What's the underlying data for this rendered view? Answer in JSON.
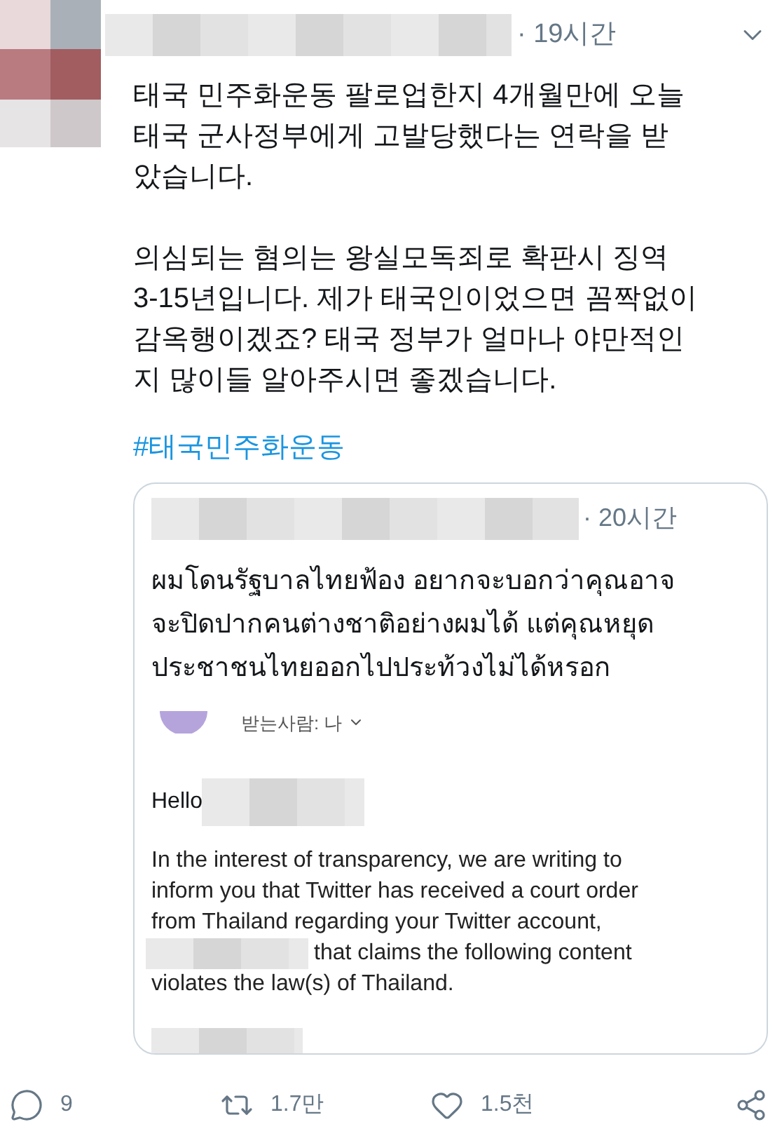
{
  "tweet": {
    "time": "· 19시간",
    "paragraphs": [
      [
        "태국 민주화운동 팔로업한지 4개월만에 오늘",
        "태국 군사정부에게 고발당했다는 연락을 받",
        "았습니다."
      ],
      [
        "의심되는 혐의는 왕실모독죄로 확판시 징역",
        "3-15년입니다. 제가 태국인이었으면 꼼짝없이",
        "감옥행이겠죠? 태국 정부가 얼마나 야만적인",
        "지 많이들 알아주시면 좋겠습니다."
      ]
    ],
    "hashtag": "#태국민주화운동",
    "quote": {
      "time": "· 20시간",
      "text_lines": [
        "ผมโดนรัฐบาลไทยฟ้อง อยากจะบอกว่าคุณอาจ",
        "จะปิดปากคนต่างชาติอย่างผมได้ แต่คุณหยุด",
        "ประชาชนไทยออกไปประท้วงไม่ได้หรอก"
      ],
      "email": {
        "recipient": "받는사람: 나",
        "greeting": "Hello",
        "body_lines": [
          {
            "text": "In the interest of transparency, we are writing to",
            "redacted_prefix": false
          },
          {
            "text": "inform you that Twitter has received a court order",
            "redacted_prefix": false
          },
          {
            "text": "from Thailand regarding your Twitter account,",
            "redacted_prefix": false
          },
          {
            "text": "that claims the following content",
            "redacted_prefix": true
          },
          {
            "text": "violates the law(s) of Thailand.",
            "redacted_prefix": false
          }
        ]
      }
    },
    "actions": [
      {
        "kind": "reply",
        "count": "9"
      },
      {
        "kind": "retweet",
        "count": "1.7만"
      },
      {
        "kind": "like",
        "count": "1.5천"
      },
      {
        "kind": "share"
      }
    ]
  }
}
